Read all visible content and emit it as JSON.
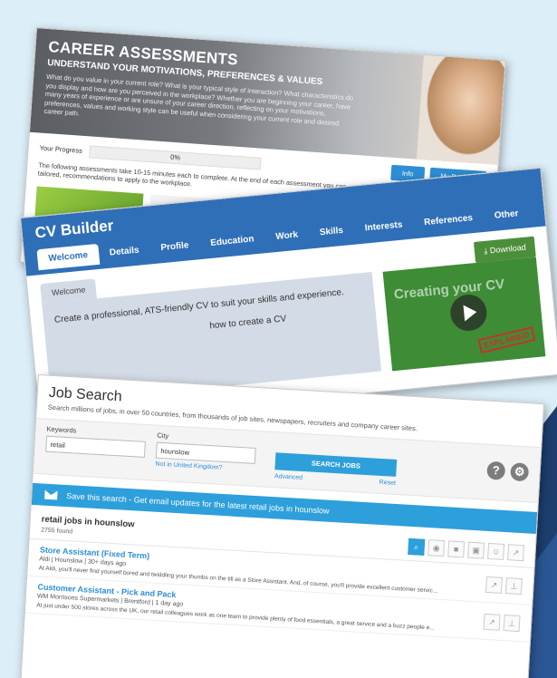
{
  "career": {
    "title": "CAREER ASSESSMENTS",
    "subtitle": "UNDERSTAND YOUR MOTIVATIONS, PREFERENCES & VALUES",
    "description": "What do you value in your current role? What is your typical style of interaction? What characteristics do you display and how are you perceived in the workplace? Whether you are beginning your career, have many years of experience or are unsure of your career direction, reflecting on your motivations, preferences, values and working style can be useful when considering your current role and desired career path.",
    "progress_label": "Your Progress",
    "progress_value": "0%",
    "progress_fraction": 0,
    "info_label": "Info",
    "reports_label": "My Reports",
    "note": "The following assessments take 10-15 minutes each to complete. At the end of each assessment you can access your personal report, with practical, tailored, recommendations to apply to the workplace."
  },
  "cv": {
    "title": "CV Builder",
    "tabs": [
      "Welcome",
      "Details",
      "Profile",
      "Education",
      "Work",
      "Skills",
      "Interests",
      "References",
      "Other"
    ],
    "welcome_tab": "Welcome",
    "welcome_line1": "Create a professional, ATS-friendly CV to suit your skills and experience.",
    "welcome_line2": "how to create a CV",
    "download_label": "Download",
    "video_text": "Creating your CV",
    "video_stamp": "EXPLAINED"
  },
  "jobs": {
    "title": "Job Search",
    "description": "Search millions of jobs, in over 50 countries, from thousands of job sites, newspapers, recruiters and company career sites.",
    "keywords_label": "Keywords",
    "keywords_value": "retail",
    "city_label": "City",
    "city_value": "hounslow",
    "not_uk_link": "Not in United Kingdom?",
    "search_button": "SEARCH JOBS",
    "advanced_link": "Advanced",
    "reset_link": "Reset",
    "save_banner": "Save this search - Get email updates for the latest retail jobs in hounslow",
    "results_title": "retail jobs in hounslow",
    "results_count": "2755 found",
    "listings": [
      {
        "title": "Store Assistant (Fixed Term)",
        "meta": "Aldi | Hounslow | 30+ days ago",
        "snippet": "At Aldi, you'll never find yourself bored and twiddling your thumbs on the till as a Store Assistant. And, of course, you'll provide excellent customer servic..."
      },
      {
        "title": "Customer Assistant - Pick and Pack",
        "meta": "WM Morrisons Supermarkets | Brentford | 1 day ago",
        "snippet": "At just under 500 stores across the UK, our retail colleagues work as one team to provide plenty of food essentials, a great service and a buzz people e..."
      }
    ]
  },
  "colors": {
    "accent_blue": "#2d9fdb",
    "cv_header": "#2f6fb8",
    "download_green": "#4b8f3a",
    "background": "#dceef8"
  }
}
